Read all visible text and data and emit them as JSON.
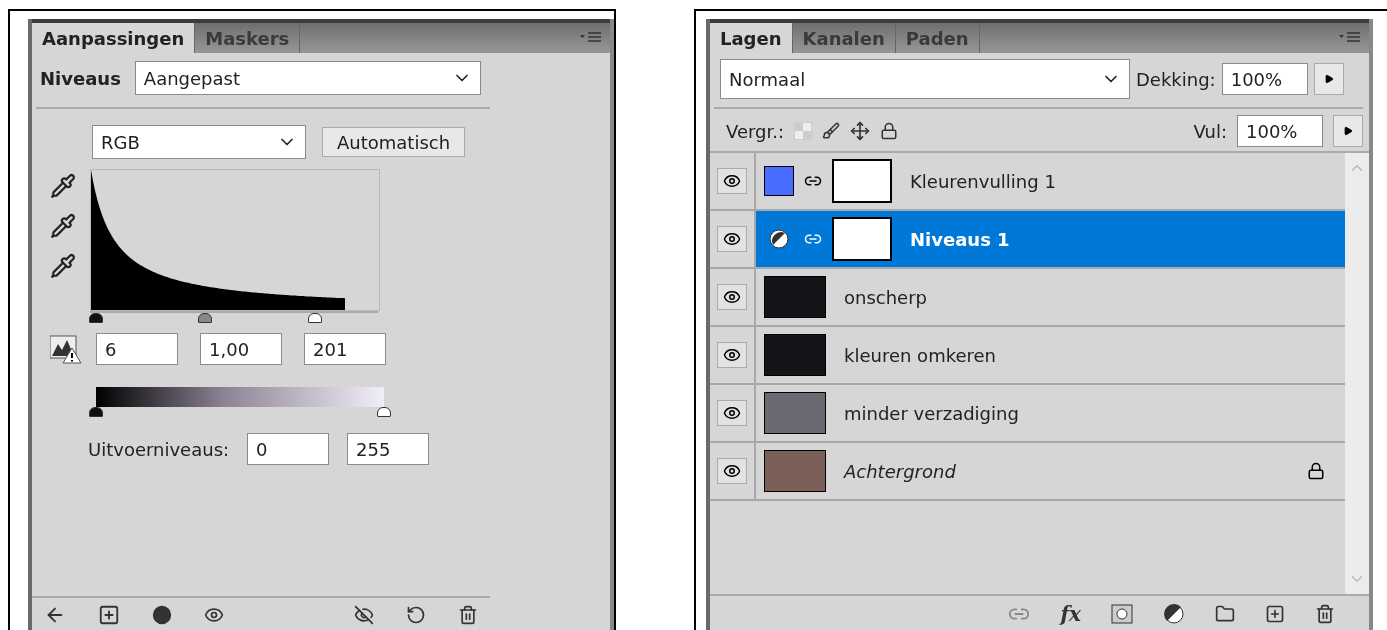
{
  "adjustments_panel": {
    "tabs": [
      {
        "label": "Aanpassingen",
        "selected": true
      },
      {
        "label": "Maskers",
        "selected": false
      }
    ],
    "adjustment_label": "Niveaus",
    "preset": {
      "value": "Aangepast"
    },
    "channel": {
      "value": "RGB"
    },
    "auto_button": "Automatisch",
    "input_thumbs": [
      {
        "kind": "black",
        "level": 0.02
      },
      {
        "kind": "gray",
        "level": 0.4
      },
      {
        "kind": "white",
        "level": 0.78
      }
    ],
    "input_values": [
      "6",
      "1,00",
      "201"
    ],
    "output_label": "Uitvoerniveaus:",
    "output_thumbs": [
      {
        "kind": "black",
        "level": 0.0
      },
      {
        "kind": "white",
        "level": 1.0
      }
    ],
    "output_values": [
      "0",
      "255"
    ]
  },
  "layers_panel": {
    "tabs": [
      {
        "label": "Lagen",
        "selected": true
      },
      {
        "label": "Kanalen",
        "selected": false
      },
      {
        "label": "Paden",
        "selected": false
      }
    ],
    "blend_mode": {
      "value": "Normaal"
    },
    "opacity": {
      "label": "Dekking:",
      "value": "100%"
    },
    "lock_label": "Vergr.:",
    "fill": {
      "label": "Vul:",
      "value": "100%"
    },
    "layers": [
      {
        "name": "Kleurenvulling 1",
        "kind": "fill",
        "color": "#4a6cff",
        "visible": true,
        "selected": false,
        "locked": false
      },
      {
        "name": "Niveaus 1",
        "kind": "adjustment",
        "visible": true,
        "selected": true,
        "locked": false
      },
      {
        "name": "onscherp",
        "kind": "pixel",
        "visible": true,
        "selected": false,
        "locked": false
      },
      {
        "name": "kleuren omkeren",
        "kind": "pixel",
        "visible": true,
        "selected": false,
        "locked": false
      },
      {
        "name": "minder verzadiging",
        "kind": "pixel",
        "visible": true,
        "selected": false,
        "locked": false
      },
      {
        "name": "Achtergrond",
        "kind": "pixel",
        "visible": true,
        "selected": false,
        "locked": true
      }
    ],
    "effects_button": "fx"
  }
}
